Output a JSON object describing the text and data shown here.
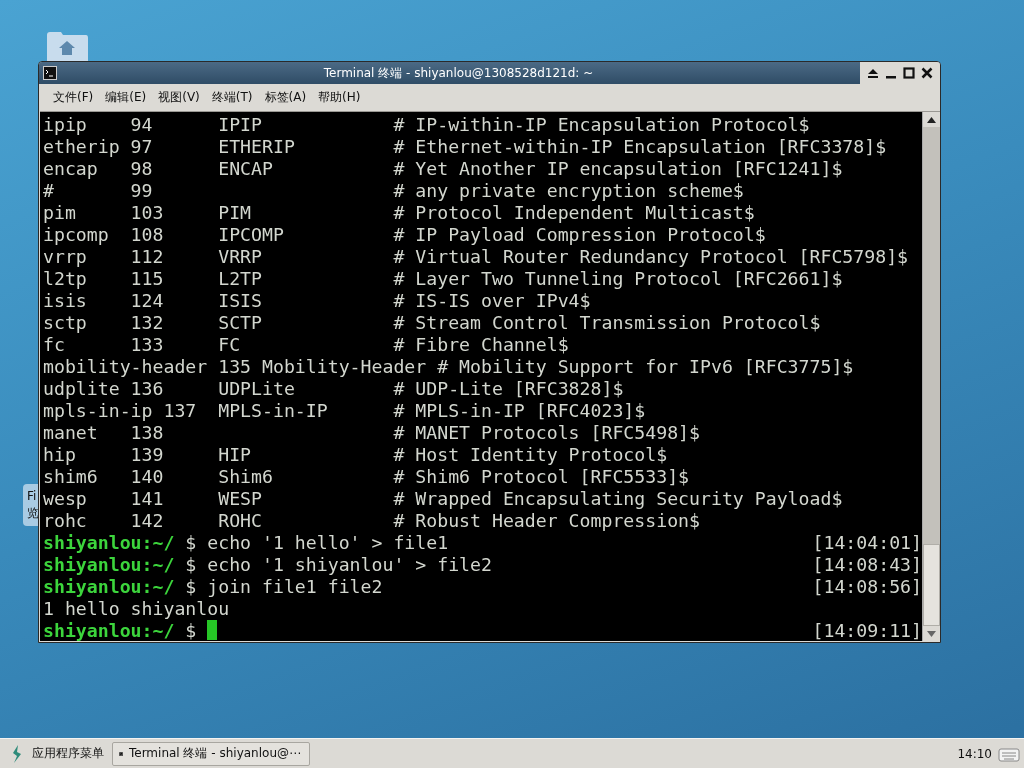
{
  "desktop": {
    "partial_label": [
      "Fi",
      "览"
    ]
  },
  "window": {
    "title": "Terminal 终端 - shiyanlou@1308528d121d: ~"
  },
  "menu": [
    "文件(F)",
    "编辑(E)",
    "视图(V)",
    "终端(T)",
    "标签(A)",
    "帮助(H)"
  ],
  "terminal": {
    "lines": [
      {
        "kind": "output",
        "text": "ipip    94      IPIP            # IP-within-IP Encapsulation Protocol$"
      },
      {
        "kind": "output",
        "text": "etherip 97      ETHERIP         # Ethernet-within-IP Encapsulation [RFC3378]$"
      },
      {
        "kind": "output",
        "text": "encap   98      ENCAP           # Yet Another IP encapsulation [RFC1241]$"
      },
      {
        "kind": "output",
        "text": "#       99                      # any private encryption scheme$"
      },
      {
        "kind": "output",
        "text": "pim     103     PIM             # Protocol Independent Multicast$"
      },
      {
        "kind": "output",
        "text": "ipcomp  108     IPCOMP          # IP Payload Compression Protocol$"
      },
      {
        "kind": "output",
        "text": "vrrp    112     VRRP            # Virtual Router Redundancy Protocol [RFC5798]$"
      },
      {
        "kind": "output",
        "text": "l2tp    115     L2TP            # Layer Two Tunneling Protocol [RFC2661]$"
      },
      {
        "kind": "output",
        "text": "isis    124     ISIS            # IS-IS over IPv4$"
      },
      {
        "kind": "output",
        "text": "sctp    132     SCTP            # Stream Control Transmission Protocol$"
      },
      {
        "kind": "output",
        "text": "fc      133     FC              # Fibre Channel$"
      },
      {
        "kind": "output",
        "text": "mobility-header 135 Mobility-Header # Mobility Support for IPv6 [RFC3775]$"
      },
      {
        "kind": "output",
        "text": "udplite 136     UDPLite         # UDP-Lite [RFC3828]$"
      },
      {
        "kind": "output",
        "text": "mpls-in-ip 137  MPLS-in-IP      # MPLS-in-IP [RFC4023]$"
      },
      {
        "kind": "output",
        "text": "manet   138                     # MANET Protocols [RFC5498]$"
      },
      {
        "kind": "output",
        "text": "hip     139     HIP             # Host Identity Protocol$"
      },
      {
        "kind": "output",
        "text": "shim6   140     Shim6           # Shim6 Protocol [RFC5533]$"
      },
      {
        "kind": "output",
        "text": "wesp    141     WESP            # Wrapped Encapsulating Security Payload$"
      },
      {
        "kind": "output",
        "text": "rohc    142     ROHC            # Robust Header Compression$"
      },
      {
        "kind": "prompt",
        "user": "shiyanlou",
        "path": ":~/",
        "symbol": "$",
        "command": "echo '1 hello' > file1",
        "time": "[14:04:01]",
        "cursor": false
      },
      {
        "kind": "prompt",
        "user": "shiyanlou",
        "path": ":~/",
        "symbol": "$",
        "command": "echo '1 shiyanlou' > file2",
        "time": "[14:08:43]",
        "cursor": false
      },
      {
        "kind": "prompt",
        "user": "shiyanlou",
        "path": ":~/",
        "symbol": "$",
        "command": "join file1 file2",
        "time": "[14:08:56]",
        "cursor": false
      },
      {
        "kind": "output",
        "text": "1 hello shiyanlou"
      },
      {
        "kind": "prompt",
        "user": "shiyanlou",
        "path": ":~/",
        "symbol": "$",
        "time": "[14:09:11]",
        "cursor": true
      }
    ]
  },
  "taskbar": {
    "menu_label": "应用程序菜单",
    "task": "Terminal 终端 - shiyanlou@⋯",
    "clock": "14:10"
  }
}
